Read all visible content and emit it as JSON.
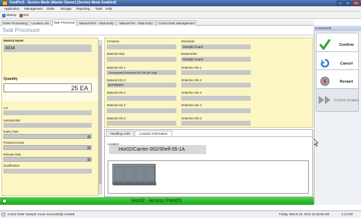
{
  "window": {
    "title": "FastPicS - Service Mode (Master Owner) [Service Mode Enabled]"
  },
  "menu": [
    "Application",
    "Management",
    "Order",
    "Storage",
    "Reporting",
    "Tools",
    "Help"
  ],
  "toolbar": {
    "startup": "Startup",
    "exit": "Exit"
  },
  "tabs": [
    "Order Processing",
    "Location List",
    "Task Processor",
    "Manual Pick - Data Entry",
    "Manual Put - Data Entry",
    "Count Order Management"
  ],
  "panel": {
    "title": "Task Processor"
  },
  "left": {
    "material_name_label": "Material Name:",
    "material_name": "3034",
    "quantity_label": "Quantity",
    "quantity": "25 EA",
    "lot_label": "Lot",
    "serial_label": "Serialnumber",
    "expiry_label": "Expiry Date",
    "production_label": "Production Date",
    "release_label": "Release Date",
    "qualification_label": "Qualification"
  },
  "middle": {
    "kit_name_label": "Kit Name:",
    "material_alias_label": "Material Alias:",
    "info1_label": "Material Info 1:",
    "info1": "Lemongrass Essential Oil 5 ml (kit only)",
    "info2_label": "Material Info 2:",
    "info2": "DOTERRA",
    "info3_label": "Material Info 3:",
    "info4_label": "Material Info 4:",
    "info5_label": "Material Info 5:"
  },
  "right": {
    "workorder_label": "Workorder",
    "workorder": "Sample Count",
    "masterorder_label": "Masterorder:",
    "masterorder": "Sample Count",
    "ol1": "Orderline Info 1:",
    "ol2": "Orderline Info 2:",
    "ol3": "Orderline Info 3:",
    "ol4": "Orderline Info 4:",
    "ol5": "Orderline Info 5:"
  },
  "subtabs": [
    "Handling Units",
    "Location Information"
  ],
  "location": {
    "label": "Location:",
    "value": "Hor02/Carrier-002/Shelf-05-1A"
  },
  "green_bar": "Hor02 - Access Point01",
  "commands": {
    "title": "Commands",
    "confirm": "Confirm",
    "cancel": "Cancel",
    "restart": "Restart",
    "confirm_location": "Confirm location"
  },
  "status": {
    "message": "Count Order Sample Count successfully created",
    "datetime": "Friday, March 23, 2012 11:45:56 AM",
    "version": "2.3.3.60"
  }
}
